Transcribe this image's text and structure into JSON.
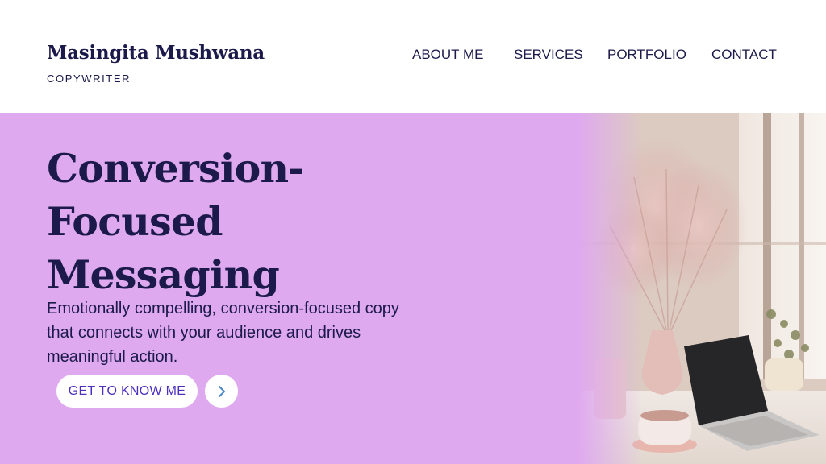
{
  "header": {
    "brand_name": "Masingita Mushwana",
    "brand_role": "COPYWRITER",
    "nav": [
      {
        "label": "ABOUT ME"
      },
      {
        "label": "SERVICES"
      },
      {
        "label": "PORTFOLIO"
      },
      {
        "label": "CONTACT"
      }
    ]
  },
  "hero": {
    "headline_lines": [
      "Conversion-",
      "Focused",
      "Messaging"
    ],
    "lede": "Emotionally compelling, conversion-focused copy that connects with your audience and drives meaningful action.",
    "cta_label": "GET TO KNOW ME",
    "next_icon": "chevron-right-icon",
    "photo_description": ""
  },
  "colors": {
    "navy": "#1b1a4a",
    "lilac": "#dfa9ef",
    "cta_text": "#4d2fbf",
    "chevron": "#4a86c8"
  }
}
